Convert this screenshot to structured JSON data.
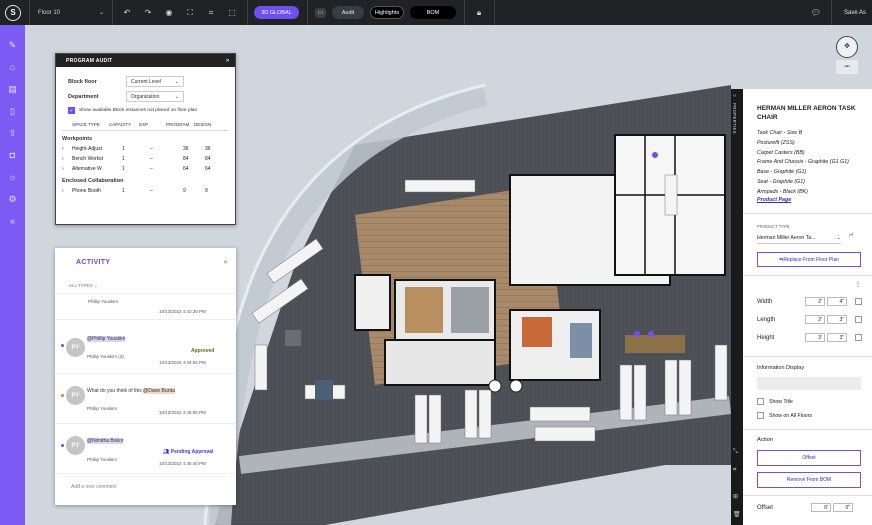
{
  "topbar": {
    "logo": "S",
    "floor_selector": "Floor 10",
    "view_pill": "3D GLOBAL",
    "audit_label": "Audit",
    "highlights_label": "Highlights",
    "bom_label": "BOM",
    "save_as": "Save As"
  },
  "program_audit": {
    "title": "PROGRAM AUDIT",
    "block_floor_label": "Block floor",
    "block_floor_value": "Current Level",
    "department_label": "Department",
    "department_value": "Organization",
    "checkbox_label": "Show available Block instances not placed on floor plan",
    "columns": [
      "SPACE TYPE",
      "CAPACITY",
      "EXP",
      "PROGRAM",
      "DESIGN"
    ],
    "groups": [
      {
        "name": "Workpoints",
        "rows": [
          {
            "type": "Height-Adjust",
            "capacity": "1",
            "exp": "–",
            "program": "36",
            "design": "36"
          },
          {
            "type": "Bench Workst",
            "capacity": "1",
            "exp": "–",
            "program": "84",
            "design": "84"
          },
          {
            "type": "Alternative W",
            "capacity": "1",
            "exp": "–",
            "program": "64",
            "design": "64"
          }
        ]
      },
      {
        "name": "Enclosed Collaboration",
        "rows": [
          {
            "type": "Phone Booth",
            "capacity": "1",
            "exp": "–",
            "program": "9",
            "design": "9"
          }
        ]
      }
    ]
  },
  "activity": {
    "title": "ACTIVITY",
    "filter": "ALL TYPES",
    "items": [
      {
        "author": "Phillip Youskim",
        "time": "10/13/2022 4:43:39 PM"
      },
      {
        "initials": "PY",
        "mention": "@Phillip Youskim",
        "status": "Approved",
        "author": "Phillip Youskim (3)",
        "time": "10/13/2022 4:44:06 PM"
      },
      {
        "initials": "PY",
        "text": "What do you think of this ",
        "mention": "@Dane Burda",
        "author": "Phillip Youskim",
        "time": "10/13/2022 4:46:05 PM"
      },
      {
        "initials": "PY",
        "mention": "@Nimitha Bokor",
        "status": "Pending Approval",
        "author": "Phillip Youskim",
        "time": "10/13/2022 4:46:40 PM"
      }
    ],
    "comment_placeholder": "Add a new comment"
  },
  "properties": {
    "tab_label": "PROPERTIES",
    "title": "HERMAN MILLER AERON TASK CHAIR",
    "specs": [
      "Task Chair - Size B",
      "Posturefit (ZSS)",
      "Carpet Casters (BB)",
      "Frame And Chassis - Graphite (G1 G1)",
      "Base - Graphite (G1)",
      "Seat - Graphite (G1)",
      "Armpads - Black (BK)"
    ],
    "product_page": "Product Page",
    "product_type_label": "PRODUCT TYPE",
    "product_type_value": "Herman Miller Aeron Ta...",
    "replace_button": "Replace From Floor Plan",
    "width_label": "Width",
    "width_ft": "2'",
    "width_in": "4\"",
    "length_label": "Length",
    "length_ft": "2'",
    "length_in": "3\"",
    "height_label": "Height",
    "height_ft": "3'",
    "height_in": "3\"",
    "info_display_label": "Information Display",
    "show_title": "Show Title",
    "show_all_floors": "Show on All Floors",
    "action_label": "Action",
    "offset_button": "Offset",
    "remove_button": "Remove From BOM",
    "offset_label": "Offset",
    "offset_x": "0'",
    "offset_y": "0\""
  },
  "colors": {
    "accent": "#6f4ef2",
    "topbar": "#1f2326",
    "rail": "#7b5bf4"
  }
}
